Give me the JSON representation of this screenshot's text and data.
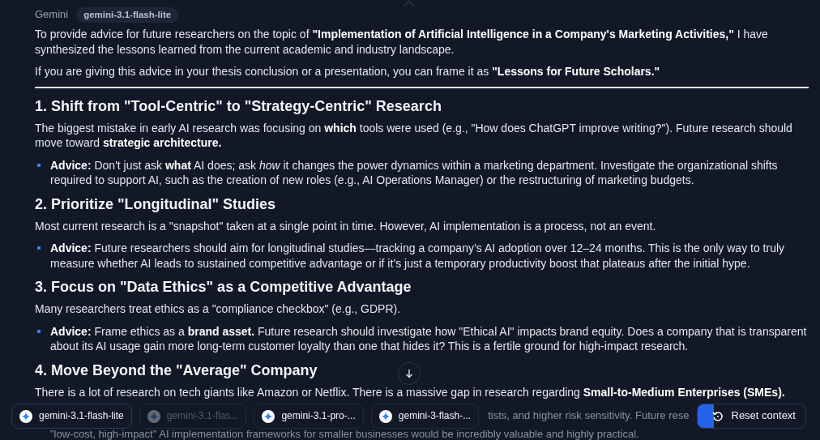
{
  "header": {
    "author": "Gemini",
    "model": "gemini-3.1-flash-lite"
  },
  "intro": [
    "To provide advice for future researchers on the topic of **\"Implementation of Artificial Intelligence in a Company's Marketing Activities,\"** I have synthesized the lessons learned from the current academic and industry landscape.",
    "If you are giving this advice in your thesis conclusion or a presentation, you can frame it as **\"Lessons for Future Scholars.\"**"
  ],
  "sections": [
    {
      "heading": "1. Shift from \"Tool-Centric\" to \"Strategy-Centric\" Research",
      "paragraph": "The biggest mistake in early AI research was focusing on **which** tools were used (e.g., \"How does ChatGPT improve writing?\"). Future research should move toward **strategic architecture.**",
      "bullets": [
        "**Advice:** Don't just ask **what** AI does; ask *how* it changes the power dynamics within a marketing department. Investigate the organizational shifts required to support AI, such as the creation of new roles (e.g., AI Operations Manager) or the restructuring of marketing budgets."
      ]
    },
    {
      "heading": "2. Prioritize \"Longitudinal\" Studies",
      "paragraph": "Most current research is a \"snapshot\" taken at a single point in time. However, AI implementation is a process, not an event.",
      "bullets": [
        "**Advice:** Future researchers should aim for longitudinal studies—tracking a company’s AI adoption over 12–24 months. This is the only way to truly measure whether AI leads to sustained competitive advantage or if it’s just a temporary productivity boost that plateaus after the initial hype."
      ]
    },
    {
      "heading": "3. Focus on \"Data Ethics\" as a Competitive Advantage",
      "paragraph": "Many researchers treat ethics as a \"compliance checkbox\" (e.g., GDPR).",
      "bullets": [
        "**Advice:** Frame ethics as a **brand asset.** Future research should investigate how \"Ethical AI\" impacts brand equity. Does a company that is transparent about its AI usage gain more long-term customer loyalty than one that hides it? This is a fertile ground for high-impact research."
      ]
    },
    {
      "heading": "4. Move Beyond the \"Average\" Company",
      "paragraph": "There is a lot of research on tech giants like Amazon or Netflix. There is a massive gap in research regarding **Small-to-Medium Enterprises (SMEs).**"
    }
  ],
  "covered_lines": [
    "tists, and higher risk sensitivity. Future rese",
    "\"low-cost, high-impact\" AI implementation frameworks for smaller businesses would be incredibly valuable and highly practical."
  ],
  "chips": [
    {
      "label": "gemini-3.1-flash-lite",
      "selected": true,
      "disabled": false
    },
    {
      "label": "gemini-3.1-flas...",
      "selected": false,
      "disabled": true
    },
    {
      "label": "gemini-3.1-pro-...",
      "selected": false,
      "disabled": false
    },
    {
      "label": "gemini-3-flash-...",
      "selected": false,
      "disabled": false
    }
  ],
  "reset": {
    "label": "Reset context",
    "level": 0.15
  }
}
